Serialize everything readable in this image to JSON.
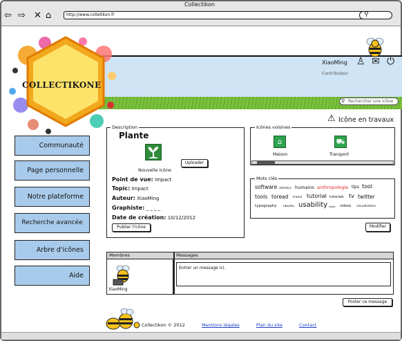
{
  "window": {
    "title": "Collectikon",
    "url": "http://www.colletikon.fr"
  },
  "brand": {
    "logo_text": "COLLECTIKONE"
  },
  "user": {
    "name": "XiaoMing",
    "role": "Contributeur"
  },
  "header": {
    "search_placeholder": "Rechercher une icône"
  },
  "nav": {
    "items": [
      {
        "label": "Communauté"
      },
      {
        "label": "Page personnelle"
      },
      {
        "label": "Notre plateforme"
      },
      {
        "label": "Recherche avancée"
      },
      {
        "label": "Arbre d'icônes"
      },
      {
        "label": "Aide"
      }
    ]
  },
  "description": {
    "legend": "Description",
    "title": "Plante",
    "caption": "Nouvelle icône",
    "upload_label": "Uploader",
    "props": [
      {
        "key": "Point de vue:",
        "value": "Impact"
      },
      {
        "key": "Topic:",
        "value": "Impact"
      },
      {
        "key": "Auteur:",
        "value": "XiaoMing"
      },
      {
        "key": "Graphiste:",
        "value": "_ _ _ _"
      },
      {
        "key": "Date de création:",
        "value": "10/12/2012"
      }
    ],
    "publish_label": "Publier l'icône"
  },
  "status": {
    "warning": "Icône en travaux"
  },
  "neighbors": {
    "legend": "Icônes voisines",
    "items": [
      {
        "label": "Maison"
      },
      {
        "label": "Transport"
      }
    ]
  },
  "tags": {
    "legend": "Mots clés",
    "items": [
      {
        "text": "software",
        "size": 7.5,
        "color": "#111"
      },
      {
        "text": "statistics",
        "size": 4,
        "color": "#111"
      },
      {
        "text": "humains",
        "size": 6.5,
        "color": "#111"
      },
      {
        "text": "anthropologie",
        "size": 6.5,
        "color": "#e02020"
      },
      {
        "text": "tips",
        "size": 6,
        "color": "#111"
      },
      {
        "text": "tool",
        "size": 8,
        "color": "#111"
      },
      {
        "text": "tools",
        "size": 7.5,
        "color": "#111"
      },
      {
        "text": "toread",
        "size": 7.5,
        "color": "#111"
      },
      {
        "text": "travel",
        "size": 4.5,
        "color": "#111"
      },
      {
        "text": "tutorial",
        "size": 8,
        "color": "#111"
      },
      {
        "text": "tutorials",
        "size": 5,
        "color": "#111"
      },
      {
        "text": "tv",
        "size": 8,
        "color": "#111"
      },
      {
        "text": "twitter",
        "size": 7.5,
        "color": "#111"
      },
      {
        "text": "typography",
        "size": 5.5,
        "color": "#111"
      },
      {
        "text": "ubuntu",
        "size": 4.5,
        "color": "#111"
      },
      {
        "text": "usability",
        "size": 10,
        "color": "#111"
      },
      {
        "text": "video",
        "size": 3.5,
        "color": "#111"
      },
      {
        "text": "videos",
        "size": 5,
        "color": "#111"
      },
      {
        "text": "visualization",
        "size": 4.5,
        "color": "#111"
      }
    ],
    "modify_label": "Modifier"
  },
  "comments": {
    "col_members": "Membres",
    "col_messages": "Messages",
    "member_name": "XiaoMing",
    "message_placeholder": "Entrer un message ici.",
    "post_label": "Poster ce message"
  },
  "footer": {
    "copyright": "Collectikon © 2012",
    "links": [
      "Mentions légales",
      "Plan du site",
      "Contact"
    ]
  },
  "colors": {
    "nav_bg": "#a9cbeb",
    "banner_bg": "#cfe4f5",
    "tag_accent": "#e02020",
    "link": "#1a3cc7"
  }
}
